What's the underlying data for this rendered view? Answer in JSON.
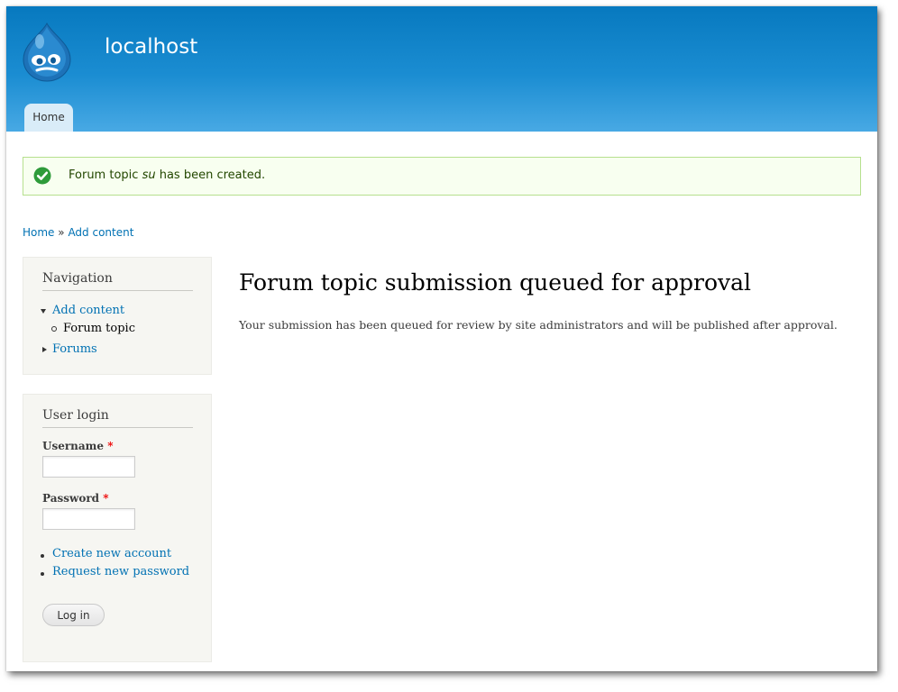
{
  "site": {
    "name": "localhost"
  },
  "tabs": [
    {
      "label": "Home"
    }
  ],
  "status": {
    "prefix": "Forum topic",
    "title": "su",
    "suffix": "has been created."
  },
  "breadcrumb": {
    "home": "Home",
    "separator": "»",
    "current": "Add content"
  },
  "navigation": {
    "title": "Navigation",
    "add_content": "Add content",
    "forum_topic": "Forum topic",
    "forums": "Forums"
  },
  "login": {
    "title": "User login",
    "username_label": "Username",
    "password_label": "Password",
    "required_mark": "*",
    "create_account": "Create new account",
    "request_password": "Request new password",
    "submit": "Log in"
  },
  "main": {
    "title": "Forum topic submission queued for approval",
    "body": "Your submission has been queued for review by site administrators and will be published after approval."
  },
  "colors": {
    "header_top": "#0779bf",
    "header_bottom": "#48a9e4",
    "link": "#0071b3",
    "status_border": "#b6e08e",
    "status_bg": "#f8fff0",
    "success_icon": "#2e9b3a"
  },
  "icons": {
    "logo": "drupal-drop-logo",
    "status": "check-circle-icon"
  }
}
